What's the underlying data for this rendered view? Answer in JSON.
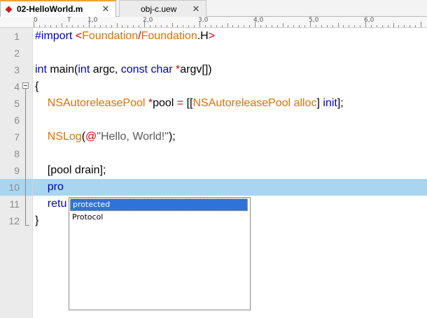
{
  "tabs": [
    {
      "label": "02-HelloWorld.m",
      "close": "✕",
      "active": true
    },
    {
      "label": "obj-c.uew",
      "close": "✕",
      "active": false
    }
  ],
  "ruler": {
    "labels": [
      "0",
      "T",
      "1,0",
      "2,0",
      "3,0",
      "4,0",
      "5,0",
      "6,0"
    ]
  },
  "editor": {
    "current_line": 10,
    "lines": [
      {
        "n": "1",
        "tokens": [
          {
            "t": "#import ",
            "c": "kw"
          },
          {
            "t": "<",
            "c": "red"
          },
          {
            "t": "Foundation",
            "c": "cls"
          },
          {
            "t": "/",
            "c": "red"
          },
          {
            "t": "Foundation",
            "c": "cls"
          },
          {
            "t": ".H",
            "c": ""
          },
          {
            "t": ">",
            "c": "red"
          }
        ]
      },
      {
        "n": "2",
        "tokens": []
      },
      {
        "n": "3",
        "tokens": [
          {
            "t": "int",
            "c": "kw"
          },
          {
            "t": " main(",
            "c": ""
          },
          {
            "t": "int",
            "c": "kw"
          },
          {
            "t": " argc, ",
            "c": ""
          },
          {
            "t": "const",
            "c": "kw"
          },
          {
            "t": " ",
            "c": ""
          },
          {
            "t": "char",
            "c": "kw"
          },
          {
            "t": " ",
            "c": ""
          },
          {
            "t": "*",
            "c": "red"
          },
          {
            "t": "argv[])",
            "c": ""
          }
        ]
      },
      {
        "n": "4",
        "tokens": [
          {
            "t": "{",
            "c": ""
          }
        ]
      },
      {
        "n": "5",
        "tokens": [
          {
            "t": "    ",
            "c": ""
          },
          {
            "t": "NSAutoreleasePool",
            "c": "cls"
          },
          {
            "t": " ",
            "c": ""
          },
          {
            "t": "*",
            "c": "red"
          },
          {
            "t": "pool ",
            "c": ""
          },
          {
            "t": "=",
            "c": "red"
          },
          {
            "t": " [[",
            "c": ""
          },
          {
            "t": "NSAutoreleasePool alloc",
            "c": "cls"
          },
          {
            "t": "] ",
            "c": ""
          },
          {
            "t": "init",
            "c": "kw"
          },
          {
            "t": "];",
            "c": ""
          }
        ]
      },
      {
        "n": "6",
        "tokens": []
      },
      {
        "n": "7",
        "tokens": [
          {
            "t": "    ",
            "c": ""
          },
          {
            "t": "NSLog",
            "c": "cls"
          },
          {
            "t": "(",
            "c": ""
          },
          {
            "t": "@",
            "c": "red"
          },
          {
            "t": "\"Hello, World!\"",
            "c": "str"
          },
          {
            "t": ");",
            "c": ""
          }
        ]
      },
      {
        "n": "8",
        "tokens": []
      },
      {
        "n": "9",
        "tokens": [
          {
            "t": "    [pool drain];",
            "c": ""
          }
        ]
      },
      {
        "n": "10",
        "tokens": [
          {
            "t": "    ",
            "c": ""
          },
          {
            "t": "pro",
            "c": "kw"
          }
        ]
      },
      {
        "n": "11",
        "tokens": [
          {
            "t": "    ",
            "c": ""
          },
          {
            "t": "retu",
            "c": "kw"
          }
        ]
      },
      {
        "n": "12",
        "tokens": [
          {
            "t": "}",
            "c": ""
          }
        ]
      }
    ]
  },
  "autocomplete": {
    "items": [
      {
        "label": "protected",
        "selected": true
      },
      {
        "label": "Protocol",
        "selected": false
      }
    ]
  }
}
